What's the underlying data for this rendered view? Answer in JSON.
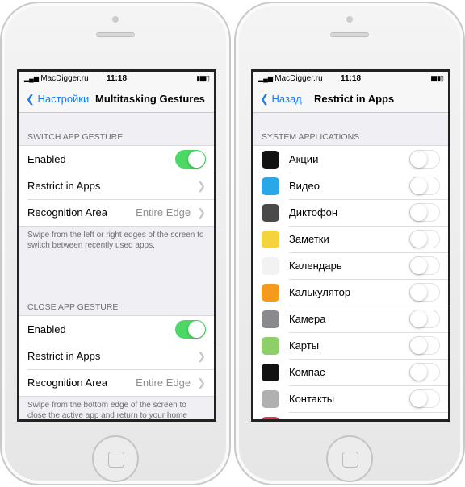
{
  "status": {
    "carrier": "MacDigger.ru",
    "time": "11:18"
  },
  "left": {
    "back": "Настройки",
    "title": "Multitasking Gestures",
    "sections": [
      {
        "header": "SWITCH APP GESTURE",
        "enabled_label": "Enabled",
        "enabled": true,
        "restrict_label": "Restrict in Apps",
        "area_label": "Recognition Area",
        "area_value": "Entire Edge",
        "footer": "Swipe from the left or right edges of the screen to switch between recently used apps."
      },
      {
        "header": "CLOSE APP GESTURE",
        "enabled_label": "Enabled",
        "enabled": true,
        "restrict_label": "Restrict in Apps",
        "area_label": "Recognition Area",
        "area_value": "Entire Edge",
        "footer": "Swipe from the bottom edge of the screen to close the active app and return to your home screen."
      }
    ]
  },
  "right": {
    "back": "Назад",
    "title": "Restrict in Apps",
    "header": "SYSTEM APPLICATIONS",
    "apps": [
      {
        "name": "Акции",
        "icon": "stocks-icon",
        "color": "#111111",
        "on": false
      },
      {
        "name": "Видео",
        "icon": "videos-icon",
        "color": "#2aa7e6",
        "on": false
      },
      {
        "name": "Диктофон",
        "icon": "voice-memos-icon",
        "color": "#4a4a4a",
        "on": false
      },
      {
        "name": "Заметки",
        "icon": "notes-icon",
        "color": "#f5d33c",
        "on": false
      },
      {
        "name": "Календарь",
        "icon": "calendar-icon",
        "color": "#f2f2f2",
        "on": false
      },
      {
        "name": "Калькулятор",
        "icon": "calculator-icon",
        "color": "#f49a1c",
        "on": false
      },
      {
        "name": "Камера",
        "icon": "camera-icon",
        "color": "#8a8a8e",
        "on": false
      },
      {
        "name": "Карты",
        "icon": "maps-icon",
        "color": "#8fcf6a",
        "on": false
      },
      {
        "name": "Компас",
        "icon": "compass-icon",
        "color": "#111111",
        "on": false
      },
      {
        "name": "Контакты",
        "icon": "contacts-icon",
        "color": "#b0b0b0",
        "on": false
      }
    ]
  },
  "colors": {
    "accent": "#1a7cf5",
    "toggle_on": "#4cd864"
  }
}
